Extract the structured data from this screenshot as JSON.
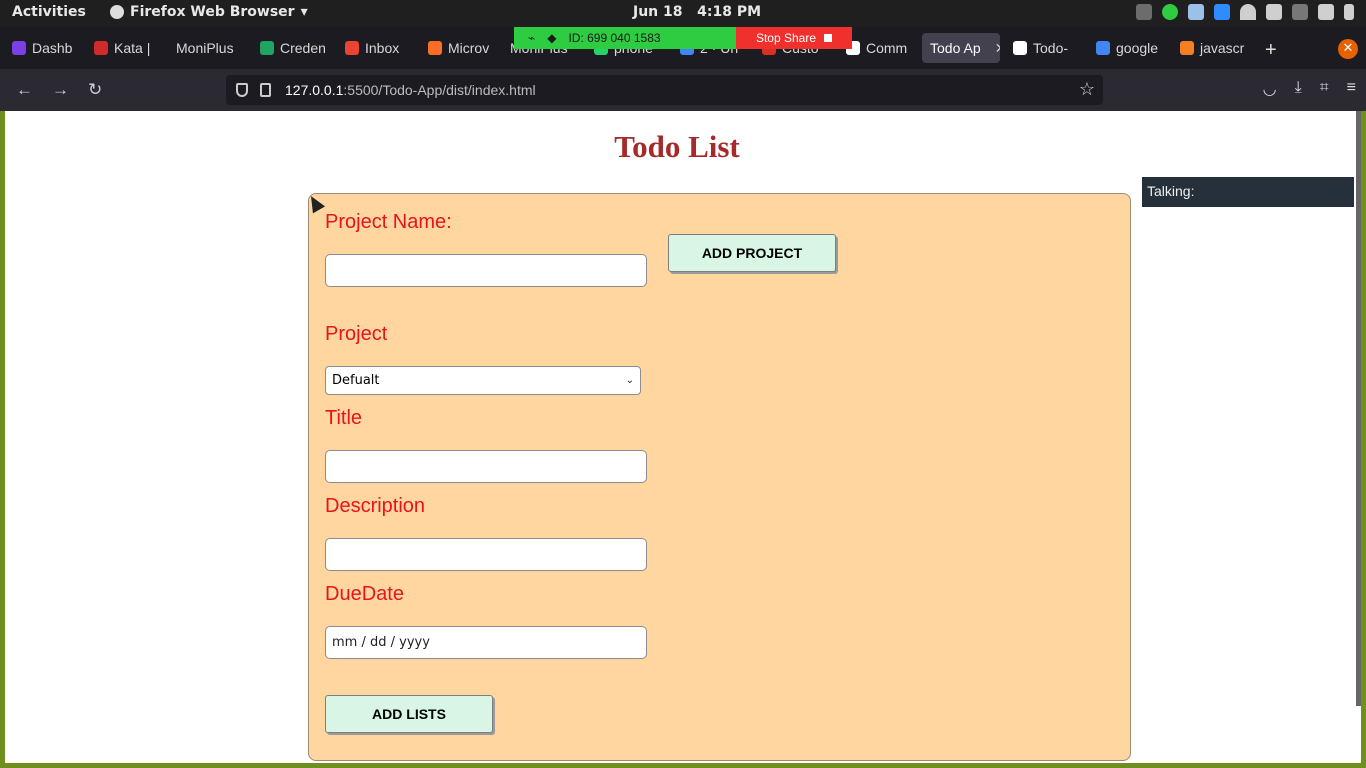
{
  "system": {
    "activities": "Activities",
    "app_name": "Firefox Web Browser",
    "clock_date": "Jun 18",
    "clock_time": "4:18 PM"
  },
  "share_banner": {
    "id_text": "ID: 699 040 1583",
    "stop_label": "Stop Share"
  },
  "tabs": [
    {
      "label": "Dashb",
      "color": "#7b3fe4"
    },
    {
      "label": "Kata |",
      "color": "#d02b2b"
    },
    {
      "label": "MoniPlus",
      "color": "#3b6fd6"
    },
    {
      "label": "Creden",
      "color": "#1fa463"
    },
    {
      "label": "Inbox",
      "color": "#ea4335"
    },
    {
      "label": "Microv",
      "color": "#fc6d26"
    },
    {
      "label": "MoniPlus",
      "color": "#3b6fd6"
    },
    {
      "label": "phone",
      "color": "#25d366"
    },
    {
      "label": "2 · Un",
      "color": "#4285f4"
    },
    {
      "label": "Custo",
      "color": "#d93025"
    },
    {
      "label": "Comm",
      "color": "#ffffff"
    },
    {
      "label": "Todo Ap",
      "color": "#42414d",
      "active": true
    },
    {
      "label": "Todo-",
      "color": "#ffffff"
    },
    {
      "label": "google",
      "color": "#4285f4"
    },
    {
      "label": "javascr",
      "color": "#f48024"
    }
  ],
  "url": {
    "host": "127.0.0.1",
    "rest": ":5500/Todo-App/dist/index.html"
  },
  "page": {
    "title": "Todo List",
    "project_name_label": "Project Name:",
    "project_name_value": "",
    "add_project_label": "ADD PROJECT",
    "project_label": "Project",
    "project_selected": "Defualt",
    "title_label": "Title",
    "title_value": "",
    "description_label": "Description",
    "description_value": "",
    "duedate_label": "DueDate",
    "duedate_placeholder": "mm / dd / yyyy",
    "add_lists_label": "ADD LISTS"
  },
  "talking_widget": {
    "label": "Talking:"
  }
}
